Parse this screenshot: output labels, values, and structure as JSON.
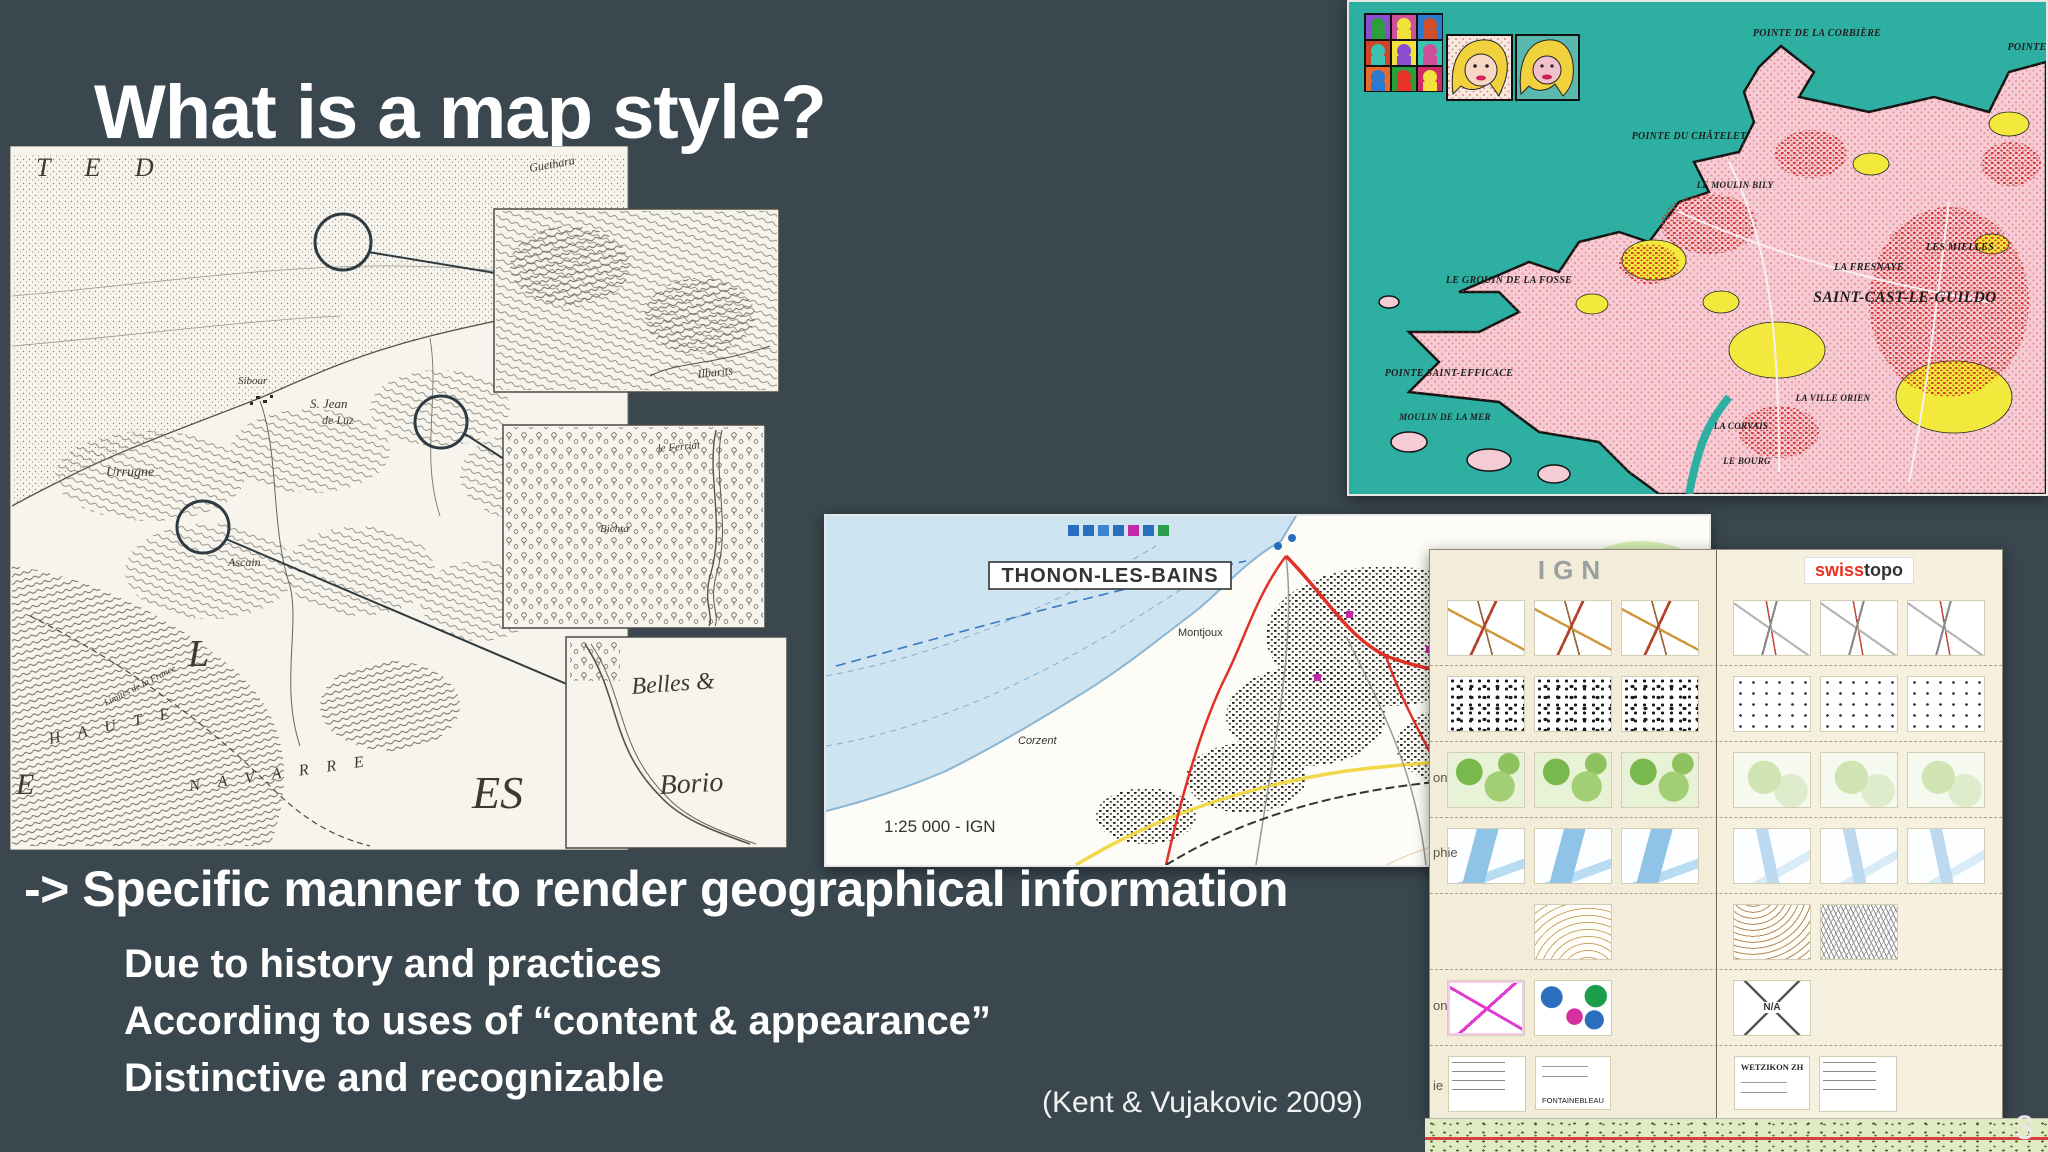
{
  "slide": {
    "title": "What is a map style?",
    "statement": "-> Specific manner to render geographical information",
    "bullets": [
      "Due to history and practices",
      "According to uses of “content & appearance”",
      "Distinctive and recognizable"
    ],
    "citation": "(Kent & Vujakovic 2009)",
    "page_number": "3"
  },
  "colors": {
    "background": "#3a474f",
    "popart_sea": "#2db0a2",
    "popart_land": "#f5ccd6",
    "popart_yellow": "#f2e93c",
    "popart_red": "#d6261f",
    "lake": "#cfe4f1",
    "road_red": "#e03127",
    "table_bg": "#f2ecd8",
    "swisstopo_red": "#e8321e"
  },
  "historical_map": {
    "sea_letters": "T E      D",
    "labels": {
      "guethara": "Guethara",
      "sibour": "Sibour",
      "st_jean_1": "S. Jean",
      "st_jean_2": "de Luz",
      "urrugne": "Urrugne",
      "ascain": "Ascain",
      "haute": "H A U T E",
      "navarre": "N A V A R R E",
      "limites": "Limites de la France",
      "big_l": "L",
      "big_e": "E",
      "es": "ES",
      "ilbarits": "Ilbarits",
      "ferriat": "le Ferriat",
      "bichta": "Bichta",
      "belles": "Belles &",
      "borio": "Borio"
    }
  },
  "popart_map": {
    "labels": {
      "corbiere": "POINTE DE LA CORBIÈRE",
      "pointe_cut": "POINTE",
      "chatelet": "POINTE DU CHÂTELET",
      "moulin_bily": "LE MOULIN BILY",
      "mielles": "LES MIELLES",
      "fresnaye": "LA FRESNAYE",
      "saint_cast": "SAINT-CAST-LE-GUILDO",
      "grouin": "LE GROUIN DE LA FOSSE",
      "efficace": "POINTE SAINT-EFFICACE",
      "ville_orien": "LA VILLE ORIEN",
      "moulin_mer": "MOULIN DE LA MER",
      "corvais": "LA CORVAIS",
      "bourg": "LE BOURG"
    }
  },
  "topo_map": {
    "title": "THONON-LES-BAINS",
    "scale_label": "1:25 000 - IGN",
    "labels": {
      "montjoux": "Montjoux",
      "corzent": "Corzent"
    }
  },
  "style_table": {
    "left_header": "IGN",
    "right_header_red": "swiss",
    "right_header_black": "topo",
    "row_labels": [
      "on",
      "phie",
      "on",
      "ie"
    ],
    "na": "N/A",
    "fontainebleau": "FONTAINEBLEAU",
    "wetzikon": "WETZIKON ZH"
  }
}
